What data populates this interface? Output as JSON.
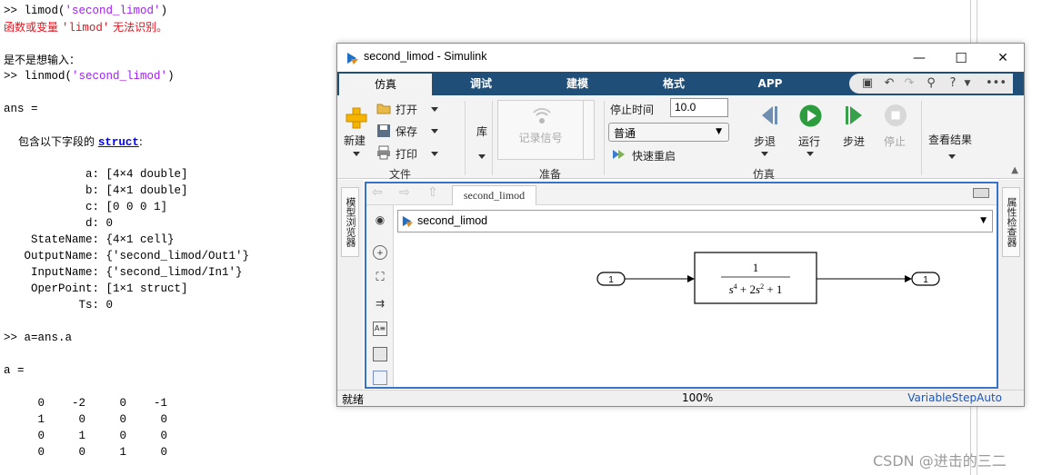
{
  "console": {
    "cmd1_prompt": ">> ",
    "cmd1_func": "limod(",
    "cmd1_arg": "'second_limod'",
    "cmd1_close": ")",
    "err_part1": "函数或变量 ",
    "err_part2": "'limod'",
    "err_part3": " 无法识别。",
    "suggest": "是不是想输入：",
    "cmd2_prompt": ">> ",
    "cmd2_func": "linmod(",
    "cmd2_arg": "'second_limod'",
    "cmd2_close": ")",
    "ans_eq": "ans =",
    "struct_prefix": "包含以下字段的 ",
    "struct_link": "struct",
    "struct_suffix": ":",
    "fields": [
      "            a: [4×4 double]",
      "            b: [4×1 double]",
      "            c: [0 0 0 1]",
      "            d: 0",
      "    StateName: {4×1 cell}",
      "   OutputName: {'second_limod/Out1'}",
      "    InputName: {'second_limod/In1'}",
      "    OperPoint: [1×1 struct]",
      "           Ts: 0"
    ],
    "cmd3": ">> a=ans.a",
    "a_eq": "a =",
    "matrix_rows": [
      "     0    -2     0    -1",
      "     1     0     0     0",
      "     0     1     0     0",
      "     0     0     1     0"
    ]
  },
  "window": {
    "title": "second_limod - Simulink",
    "minimize": "—",
    "maximize": "☐",
    "close": "✕"
  },
  "tabs": [
    "仿真",
    "调试",
    "建模",
    "格式",
    "APP"
  ],
  "ribbon": {
    "new_label": "新建",
    "open_label": "打开",
    "save_label": "保存",
    "print_label": "打印",
    "file_section": "文件",
    "library_label": "库",
    "record_signal": "记录信号",
    "prepare_section": "准备",
    "stop_time_label": "停止时间",
    "stop_time_value": "10.0",
    "mode_value": "普通",
    "fast_restart": "快速重启",
    "step_back": "步退",
    "run": "运行",
    "step_forward": "步进",
    "stop": "停止",
    "simulation_section": "仿真",
    "review_results": "查看结果"
  },
  "side_tabs": {
    "left": "模型浏览器",
    "right": "属性检查器"
  },
  "editor": {
    "canvas_tab": "second_limod",
    "address": "second_limod"
  },
  "diagram": {
    "inport_label": "1",
    "outport_label": "1",
    "tf_numerator": "1"
  },
  "status": {
    "left": "就绪",
    "zoom": "100%",
    "solver": "VariableStepAuto"
  },
  "watermark": "CSDN @进击的三二",
  "colors": {
    "tab_bar": "#1f4e79",
    "string_purple": "#a020f0",
    "error_red": "#e0141e",
    "solver_blue": "#1a55c0"
  }
}
